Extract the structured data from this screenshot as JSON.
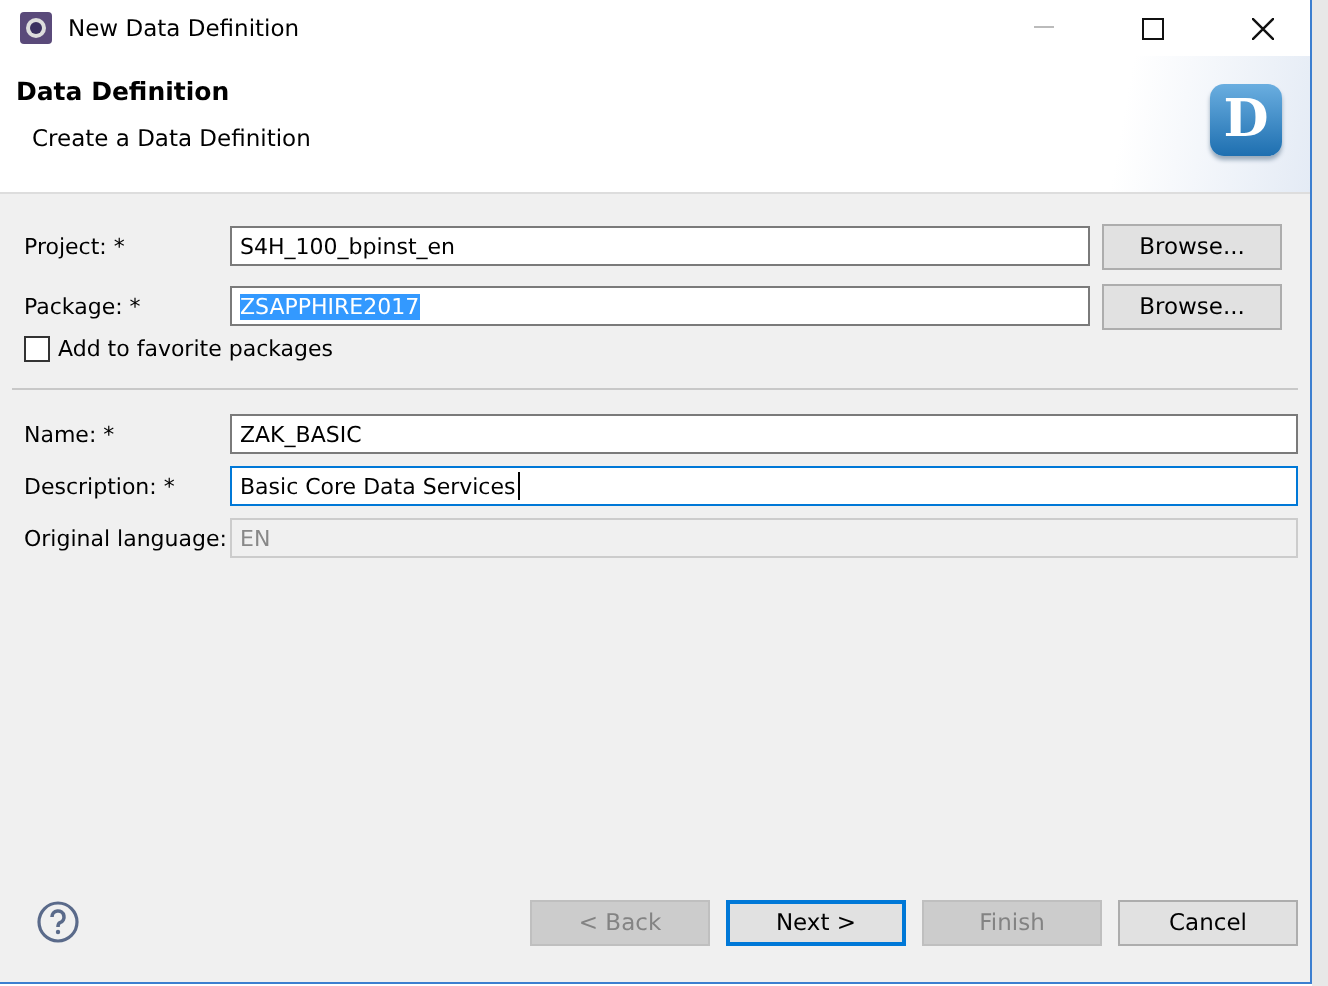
{
  "window": {
    "title": "New Data Definition"
  },
  "header": {
    "title": "Data Definition",
    "subtitle": "Create a Data Definition",
    "logo_letter": "D"
  },
  "project_fields": [
    {
      "label": "Project: *",
      "value": "S4H_100_bpinst_en",
      "highlighted": false,
      "browse": "Browse..."
    },
    {
      "label": "Package: *",
      "value": "ZSAPPHIRE2017",
      "highlighted": true,
      "browse": "Browse..."
    }
  ],
  "favorite": {
    "label": "Add to favorite packages",
    "checked": false
  },
  "fields": [
    {
      "label": "Name: *",
      "value": "ZAK_BASIC",
      "focused": false,
      "disabled": false
    },
    {
      "label": "Description: *",
      "value": "Basic Core Data Services",
      "focused": true,
      "disabled": false
    },
    {
      "label": "Original language:",
      "value": "EN",
      "focused": false,
      "disabled": true
    }
  ],
  "buttons": [
    {
      "label": "< Back",
      "disabled": true,
      "default": false
    },
    {
      "label": "Next >",
      "disabled": false,
      "default": true
    },
    {
      "label": "Finish",
      "disabled": true,
      "default": false
    },
    {
      "label": "Cancel",
      "disabled": false,
      "default": false
    }
  ]
}
